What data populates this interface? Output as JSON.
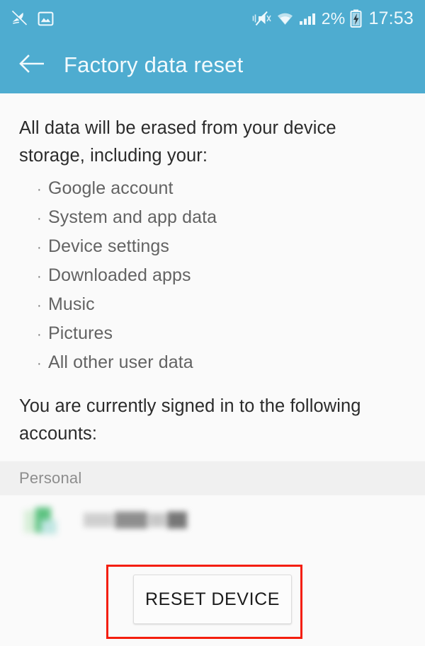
{
  "statusbar": {
    "left_icons": [
      {
        "name": "no-sim-icon",
        "glyph": "✈"
      },
      {
        "name": "screenshot-image-icon",
        "glyph": "ὛC"
      }
    ],
    "vibrate_icon": "vibrate-mute-icon",
    "wifi_icon": "wifi-icon",
    "signal_icon": "cellular-signal-icon",
    "battery_percent": "2%",
    "battery_icon": "battery-charging-icon",
    "clock": "17:53"
  },
  "appbar": {
    "back_icon": "back-arrow-icon",
    "title": "Factory data reset"
  },
  "body": {
    "intro": "All data will be erased from your device storage, including your:",
    "bullet_marker": "·",
    "bullets": [
      "Google account",
      "System and app data",
      "Device settings",
      "Downloaded apps",
      "Music",
      "Pictures",
      "All other user data"
    ],
    "signed_in_text": "You are currently signed in to the following accounts:"
  },
  "accounts_section": {
    "header": "Personal",
    "rows": [
      {
        "avatar": "account-avatar-icon",
        "name": ""
      }
    ]
  },
  "footer": {
    "reset_button_label": "RESET DEVICE"
  },
  "colors": {
    "accent": "#4eacd0",
    "annotation": "#f41e0e",
    "page_background": "#fafafa",
    "section_header_background": "#f0f0f0",
    "body_text": "#2b2b2b",
    "bullet_text": "#636363"
  }
}
